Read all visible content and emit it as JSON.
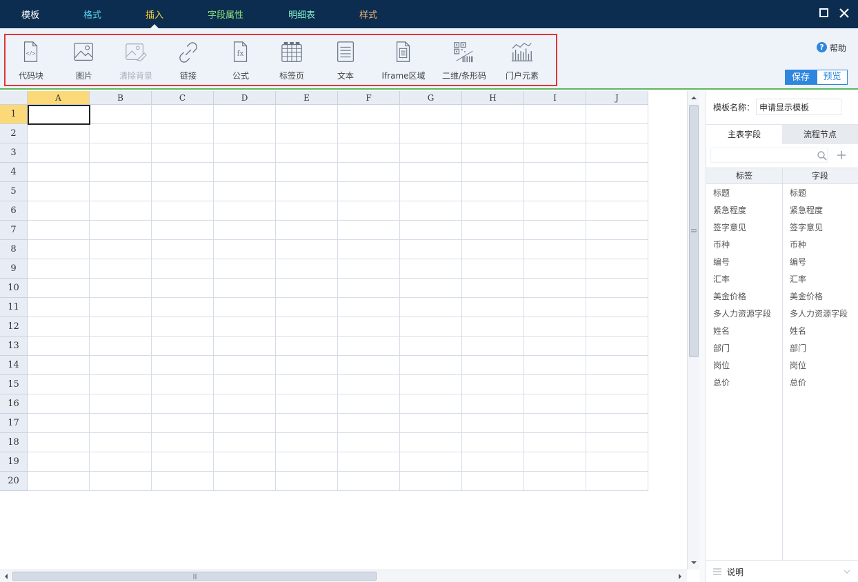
{
  "menu": {
    "tabs": [
      {
        "label": "模板",
        "color": "#ffffff"
      },
      {
        "label": "格式",
        "color": "#5bd4f0"
      },
      {
        "label": "插入",
        "color": "#f5d13a"
      },
      {
        "label": "字段属性",
        "color": "#8ee07a"
      },
      {
        "label": "明细表",
        "color": "#7fe8c6"
      },
      {
        "label": "样式",
        "color": "#f7b67a"
      }
    ],
    "active_tab": "插入"
  },
  "ribbon": {
    "tools": [
      {
        "label": "代码块",
        "icon": "code-block-icon",
        "enabled": true
      },
      {
        "label": "图片",
        "icon": "image-icon",
        "enabled": true
      },
      {
        "label": "清除背景",
        "icon": "clear-background-icon",
        "enabled": false
      },
      {
        "label": "链接",
        "icon": "link-icon",
        "enabled": true
      },
      {
        "label": "公式",
        "icon": "formula-icon",
        "enabled": true
      },
      {
        "label": "标签页",
        "icon": "tab-page-icon",
        "enabled": true
      },
      {
        "label": "文本",
        "icon": "text-icon",
        "enabled": true
      },
      {
        "label": "Iframe区域",
        "icon": "iframe-icon",
        "enabled": true
      },
      {
        "label": "二维/条形码",
        "icon": "qr-barcode-icon",
        "enabled": true
      },
      {
        "label": "门户元素",
        "icon": "portal-element-icon",
        "enabled": true
      }
    ],
    "help_label": "帮助",
    "save_label": "保存",
    "preview_label": "预览"
  },
  "sheet": {
    "columns": [
      "A",
      "B",
      "C",
      "D",
      "E",
      "F",
      "G",
      "H",
      "I",
      "J"
    ],
    "rows": [
      "1",
      "2",
      "3",
      "4",
      "5",
      "6",
      "7",
      "8",
      "9",
      "10",
      "11",
      "12",
      "13",
      "14",
      "15",
      "16",
      "17",
      "18",
      "19",
      "20"
    ],
    "selected_cell": "A1"
  },
  "panel": {
    "template_name_label": "模板名称：",
    "template_name_value": "申请显示模板",
    "tabs": [
      "主表字段",
      "流程节点"
    ],
    "active_tab": "主表字段",
    "search_placeholder": "",
    "list_headers": [
      "标签",
      "字段"
    ],
    "fields": [
      {
        "label": "标题",
        "field": "标题"
      },
      {
        "label": "紧急程度",
        "field": "紧急程度"
      },
      {
        "label": "签字意见",
        "field": "签字意见"
      },
      {
        "label": "币种",
        "field": "币种"
      },
      {
        "label": "编号",
        "field": "编号"
      },
      {
        "label": "汇率",
        "field": "汇率"
      },
      {
        "label": "美金价格",
        "field": "美金价格"
      },
      {
        "label": "多人力资源字段",
        "field": "多人力资源字段"
      },
      {
        "label": "姓名",
        "field": "姓名"
      },
      {
        "label": "部门",
        "field": "部门"
      },
      {
        "label": "岗位",
        "field": "岗位"
      },
      {
        "label": "总价",
        "field": "总价"
      }
    ],
    "notes_label": "说明"
  },
  "colors": {
    "topbar": "#0c2d4f",
    "ribbon_bg": "#eef3fa",
    "highlight_box": "#e03535",
    "accent_blue": "#2f86de",
    "selected_header": "#fbd978"
  }
}
